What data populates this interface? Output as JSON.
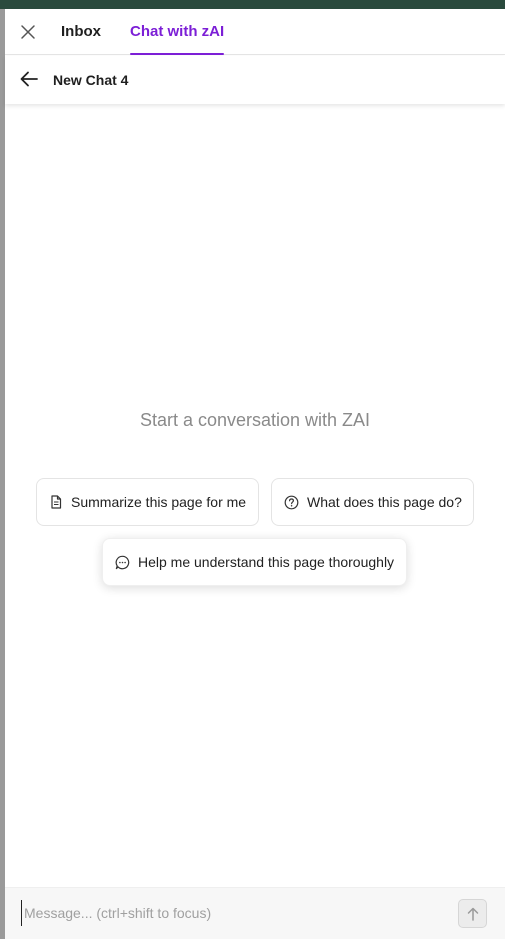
{
  "tabs": {
    "inbox_label": "Inbox",
    "chat_label": "Chat with zAI",
    "active": "chat"
  },
  "chat": {
    "title": "New Chat 4",
    "empty_state": "Start a conversation with ZAI"
  },
  "suggestions": [
    {
      "label": "Summarize this page for me",
      "icon": "document-icon"
    },
    {
      "label": "What does this page do?",
      "icon": "question-circle-icon"
    },
    {
      "label": "Help me understand this page thoroughly",
      "icon": "chat-bubble-icon"
    }
  ],
  "composer": {
    "placeholder": "Message... (ctrl+shift to focus)",
    "value": ""
  },
  "colors": {
    "accent": "#7c1fd6",
    "top_strip": "#2a4a3d"
  }
}
